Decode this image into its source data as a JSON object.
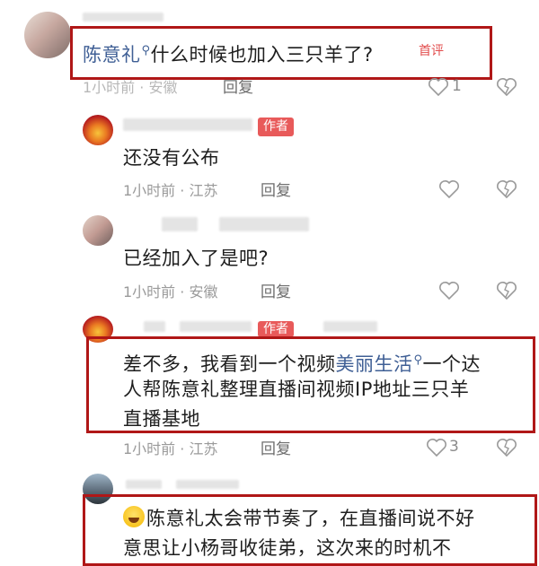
{
  "comments": [
    {
      "user": "陈意礼",
      "text": "什么时候也加入三只羊了?",
      "badge": "首评",
      "time": "1小时前 · 安徽",
      "reply": "回复",
      "likes": "1"
    },
    {
      "author_badge": "作者",
      "text": "还没有公布",
      "time": "1小时前 · 江苏",
      "reply": "回复"
    },
    {
      "text": "已经加入了是吧?",
      "time": "1小时前 · 安徽",
      "reply": "回复"
    },
    {
      "author_badge": "作者",
      "text_a": "差不多，我看到一个视频",
      "text_link": "美丽生活",
      "text_b": "一个达",
      "text_line2": "人帮陈意礼整理直播间视频IP地址三只羊",
      "text_line3": "直播基地",
      "time": "1小时前 · 江苏",
      "reply": "回复",
      "likes": "3"
    },
    {
      "text_line1": "陈意礼太会带节奏了，在直播间说不好",
      "text_line2": "意思让小杨哥收徒弟，这次来的时机不"
    }
  ],
  "colors": {
    "red_box": "#b01717",
    "author_badge": "#e85a5a",
    "name_link": "#3f5f95"
  },
  "icons": [
    "search-icon",
    "heart-icon",
    "broken-heart-icon",
    "laughing-emoji-icon"
  ]
}
